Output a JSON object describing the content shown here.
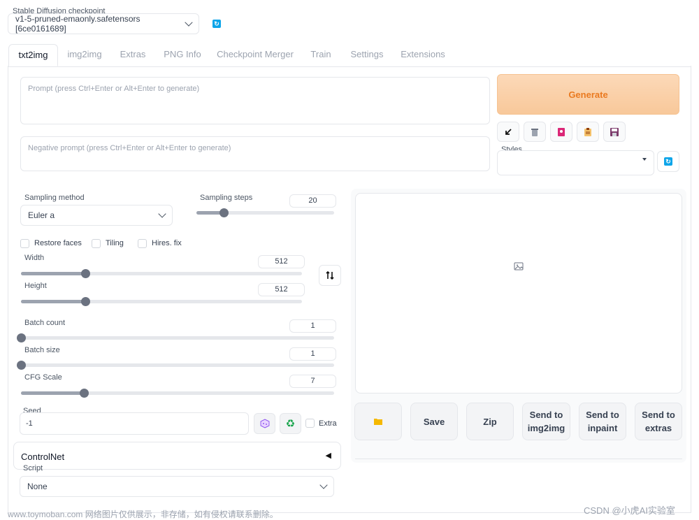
{
  "checkpoint": {
    "label": "Stable Diffusion checkpoint",
    "value": "v1-5-pruned-emaonly.safetensors [6ce0161689]"
  },
  "tabs": [
    "txt2img",
    "img2img",
    "Extras",
    "PNG Info",
    "Checkpoint Merger",
    "Train",
    "Settings",
    "Extensions"
  ],
  "prompt": {
    "placeholder": "Prompt (press Ctrl+Enter or Alt+Enter to generate)"
  },
  "negative_prompt": {
    "placeholder": "Negative prompt (press Ctrl+Enter or Alt+Enter to generate)"
  },
  "generate": {
    "label": "Generate"
  },
  "styles": {
    "label": "Styles"
  },
  "sampling": {
    "method_label": "Sampling method",
    "method_value": "Euler a",
    "steps_label": "Sampling steps",
    "steps_value": "20",
    "steps_fraction": 0.2
  },
  "options": {
    "restore_faces": "Restore faces",
    "tiling": "Tiling",
    "hires_fix": "Hires. fix"
  },
  "width": {
    "label": "Width",
    "value": "512",
    "fraction": 0.23
  },
  "height": {
    "label": "Height",
    "value": "512",
    "fraction": 0.23
  },
  "batch_count": {
    "label": "Batch count",
    "value": "1",
    "fraction": 0.0
  },
  "batch_size": {
    "label": "Batch size",
    "value": "1",
    "fraction": 0.0
  },
  "cfg_scale": {
    "label": "CFG Scale",
    "value": "7",
    "fraction": 0.2
  },
  "seed": {
    "label": "Seed",
    "value": "-1",
    "extra_label": "Extra"
  },
  "controlnet": {
    "label": "ControlNet",
    "arrow": "◀"
  },
  "script": {
    "label": "Script",
    "value": "None"
  },
  "output_buttons": {
    "save": "Save",
    "zip": "Zip",
    "send_img2img_line1": "Send to",
    "send_img2img_line2": "img2img",
    "send_inpaint_line1": "Send to",
    "send_inpaint_line2": "inpaint",
    "send_extras_line1": "Send to",
    "send_extras_line2": "extras"
  },
  "watermark": {
    "left": "www.toymoban.com 网络图片仅供展示，非存储，如有侵权请联系删除。",
    "right": "CSDN @小虎AI实验室"
  },
  "colors": {
    "accent_orange": "#f59e5b",
    "refresh_blue": "#0ea5e9",
    "recycle_green": "#16a34a"
  }
}
